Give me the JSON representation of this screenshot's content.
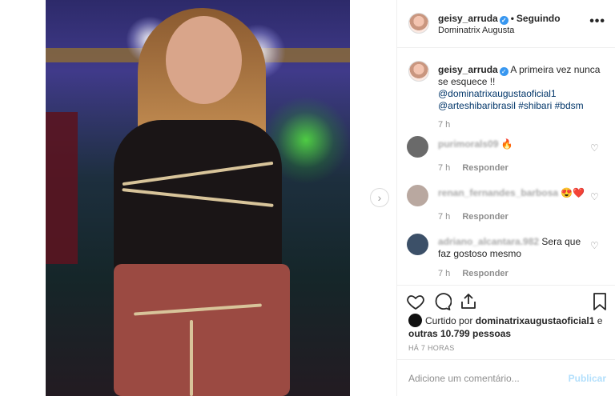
{
  "post": {
    "username": "geisy_arruda",
    "follow_state": "Seguindo",
    "location": "Dominatrix Augusta",
    "more_icon": "more-horizontal-icon"
  },
  "caption": {
    "username": "geisy_arruda",
    "text_line1": "A primeira vez nunca",
    "text_line2": "se esquece !!",
    "tag1": "@dominatrixaugustaoficial1",
    "tag2": "@arteshibaribrasil",
    "tag3": "#shibari",
    "tag4": "#bdsm",
    "time": "7 h"
  },
  "comments": [
    {
      "username": "purimorals09",
      "text": "",
      "emoji": "🔥",
      "time": "7 h",
      "reply_label": "Responder"
    },
    {
      "username": "renan_fernandes_barbosa",
      "text": "",
      "emoji": "😍❤️",
      "time": "7 h",
      "reply_label": "Responder"
    },
    {
      "username": "adriano_alcantara.982",
      "text": "Sera que faz gostoso mesmo",
      "emoji": "",
      "time": "7 h",
      "reply_label": "Responder"
    }
  ],
  "likes": {
    "prefix": "Curtido por",
    "user": "dominatrixaugustaoficial1",
    "connector": "e",
    "others": "outras 10.799 pessoas"
  },
  "date_label": "HÁ 7 HORAS",
  "comment_box": {
    "placeholder": "Adicione um comentário...",
    "post_label": "Publicar"
  },
  "colors": {
    "link": "#003569",
    "verified": "#3897f0",
    "muted": "#8e8e8e",
    "publish_disabled": "#b2dffc"
  }
}
